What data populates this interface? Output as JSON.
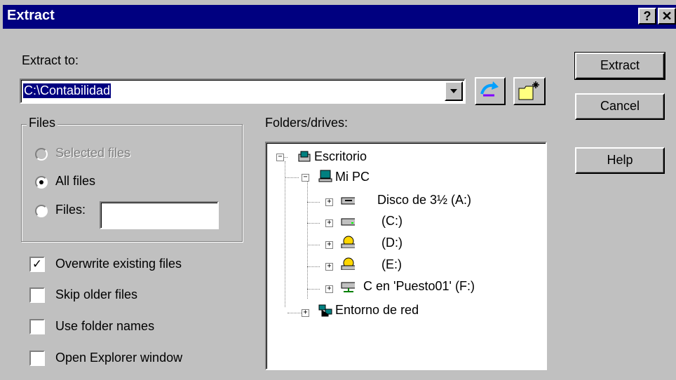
{
  "window": {
    "title": "Extract",
    "help_btn": "?",
    "close_btn": "✕"
  },
  "extract_to": {
    "label": "Extract to:",
    "value": "C:\\Contabilidad"
  },
  "files_group": {
    "title": "Files",
    "options": [
      {
        "label": "Selected files",
        "state": "disabled"
      },
      {
        "label": "All files",
        "state": "selected"
      },
      {
        "label": "Files:",
        "state": "unselected",
        "value": ""
      }
    ]
  },
  "checkboxes": [
    {
      "label": "Overwrite existing files",
      "checked": true
    },
    {
      "label": "Skip older files",
      "checked": false
    },
    {
      "label": "Use folder names",
      "checked": false
    },
    {
      "label": "Open Explorer window",
      "checked": false
    }
  ],
  "folders": {
    "label": "Folders/drives:",
    "tree": [
      {
        "label": "Escritorio",
        "icon": "desktop-icon",
        "expander": "−"
      },
      {
        "label": "Mi PC",
        "icon": "computer-icon",
        "expander": "−"
      },
      {
        "label": "Disco de 3½ (A:)",
        "icon": "floppy-drive-icon",
        "expander": "+"
      },
      {
        "label": "(C:)",
        "icon": "hard-drive-icon",
        "expander": "+"
      },
      {
        "label": "(D:)",
        "icon": "cd-drive-icon",
        "expander": "+"
      },
      {
        "label": "(E:)",
        "icon": "cd-drive-icon",
        "expander": "+"
      },
      {
        "label": "C en 'Puesto01' (F:)",
        "icon": "network-drive-icon",
        "expander": "+"
      },
      {
        "label": "Entorno de red",
        "icon": "network-neighborhood-icon",
        "expander": "+"
      }
    ]
  },
  "buttons": {
    "extract": "Extract",
    "cancel": "Cancel",
    "help": "Help"
  },
  "colors": {
    "title_bg": "#000080",
    "face": "#c0c0c0",
    "selection": "#000080"
  }
}
